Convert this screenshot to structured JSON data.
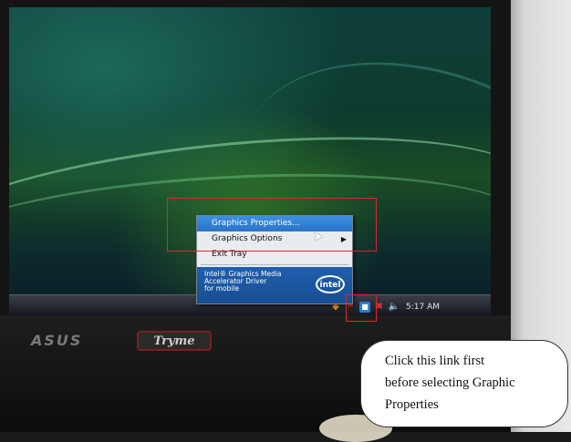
{
  "colors": {
    "annotation_red": "#e0262a",
    "menu_highlight": "#2b73c8",
    "intel_blue": "#1f5fae"
  },
  "screen": {
    "context_menu": {
      "items": [
        {
          "label": "Graphics Properties...",
          "highlighted": true,
          "has_submenu": false
        },
        {
          "label": "Graphics Options",
          "highlighted": false,
          "has_submenu": true
        },
        {
          "label": "Exit Tray",
          "highlighted": false,
          "has_submenu": false
        }
      ],
      "banner": {
        "line1": "Intel® Graphics Media",
        "line2": "Accelerator Driver",
        "line3": "for mobile",
        "logo_text": "intel"
      }
    },
    "taskbar": {
      "tray_icons": [
        "shield-icon",
        "flag-icon",
        "intel-graphics-icon",
        "network-icon",
        "volume-icon"
      ],
      "clock": "5:17 AM"
    }
  },
  "bezel": {
    "brand_logo": "ASUS",
    "sticker": "Tryme"
  },
  "annotation": {
    "callout_line1": "Click this link first",
    "callout_line2": "before selecting Graphic",
    "callout_line3": "Properties"
  }
}
